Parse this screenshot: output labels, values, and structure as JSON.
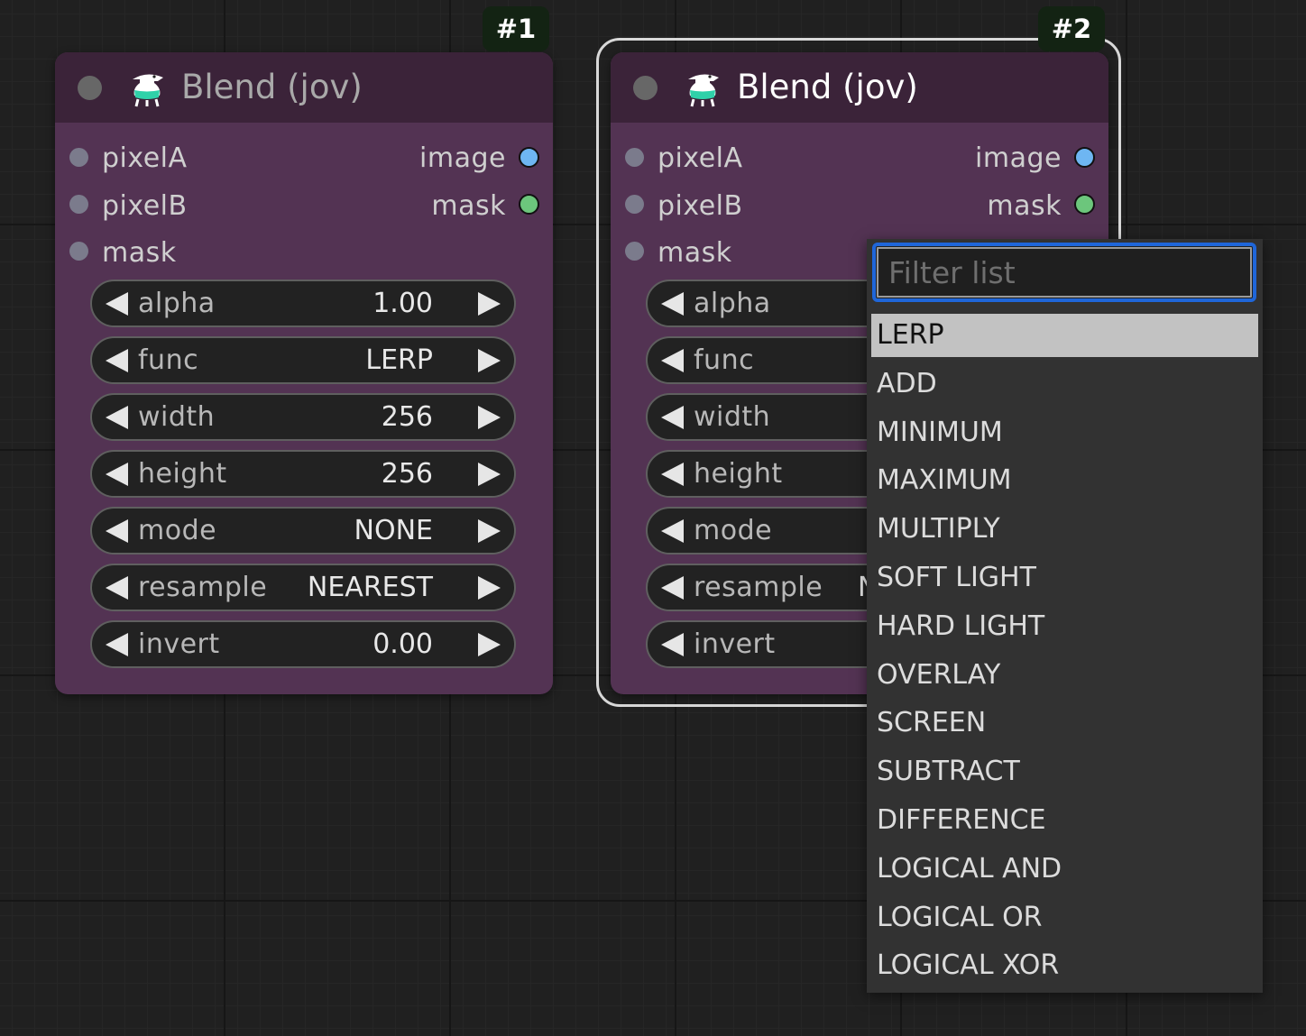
{
  "nodes": [
    {
      "badge": "#1",
      "title": "Blend (jov)",
      "inputs": [
        "pixelA",
        "pixelB",
        "mask"
      ],
      "outputs": [
        "image",
        "mask"
      ],
      "widgets": [
        {
          "name": "alpha",
          "value": "1.00"
        },
        {
          "name": "func",
          "value": "LERP"
        },
        {
          "name": "width",
          "value": "256"
        },
        {
          "name": "height",
          "value": "256"
        },
        {
          "name": "mode",
          "value": "NONE"
        },
        {
          "name": "resample",
          "value": "NEAREST"
        },
        {
          "name": "invert",
          "value": "0.00"
        }
      ]
    },
    {
      "badge": "#2",
      "title": "Blend (jov)",
      "inputs": [
        "pixelA",
        "pixelB",
        "mask"
      ],
      "outputs": [
        "image",
        "mask"
      ],
      "widgets": [
        {
          "name": "alpha",
          "value": ""
        },
        {
          "name": "func",
          "value": ""
        },
        {
          "name": "width",
          "value": ""
        },
        {
          "name": "height",
          "value": ""
        },
        {
          "name": "mode",
          "value": ""
        },
        {
          "name": "resample",
          "value": "N"
        },
        {
          "name": "invert",
          "value": ""
        }
      ]
    }
  ],
  "dropdown": {
    "placeholder": "Filter list",
    "selected_index": 0,
    "options": [
      "LERP",
      "ADD",
      "MINIMUM",
      "MAXIMUM",
      "MULTIPLY",
      "SOFT LIGHT",
      "HARD LIGHT",
      "OVERLAY",
      "SCREEN",
      "SUBTRACT",
      "DIFFERENCE",
      "LOGICAL AND",
      "LOGICAL OR",
      "LOGICAL XOR"
    ]
  },
  "colors": {
    "node_body": "#533353",
    "node_header": "#3b2339",
    "image_slot": "#6eb6f2",
    "mask_slot": "#6cc67c",
    "focus_border": "#1f66d9"
  }
}
